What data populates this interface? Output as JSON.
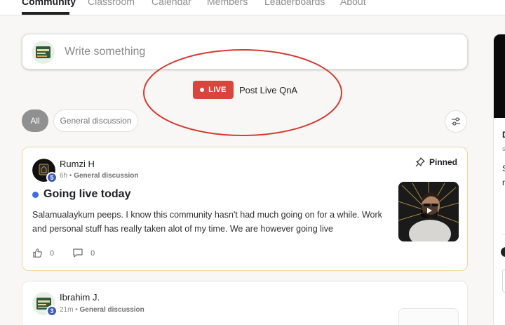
{
  "nav": {
    "tabs": [
      {
        "label": "Community",
        "active": true
      },
      {
        "label": "Classroom"
      },
      {
        "label": "Calendar"
      },
      {
        "label": "Members"
      },
      {
        "label": "Leaderboards"
      },
      {
        "label": "About"
      }
    ]
  },
  "composer": {
    "placeholder": "Write something"
  },
  "live": {
    "badge": "LIVE",
    "text": "Post Live QnA"
  },
  "filters": [
    "All",
    "General discussion"
  ],
  "posts": [
    {
      "author": "Rumzi H",
      "level": "5",
      "time": "6h",
      "category": "General discussion",
      "pinned_label": "Pinned",
      "title": "Going live today",
      "body": "Salamualaykum peeps. I know this community hasn't had much going on for a while. Work and personal stuff has really taken alot of my time. We are however going live",
      "likes": "0",
      "comments": "0"
    },
    {
      "author": "Ibrahim J.",
      "level": "3",
      "time": "21m",
      "category": "General discussion"
    }
  ],
  "sidebar": {
    "fragments": [
      "D",
      "s",
      "S",
      "n"
    ]
  },
  "colors": {
    "live_red": "#d9453d",
    "annotation_red": "#d63a2f",
    "level_badge": "#3f5bb8",
    "new_dot": "#3b6ee8",
    "pinned_border": "#f0d79a"
  }
}
